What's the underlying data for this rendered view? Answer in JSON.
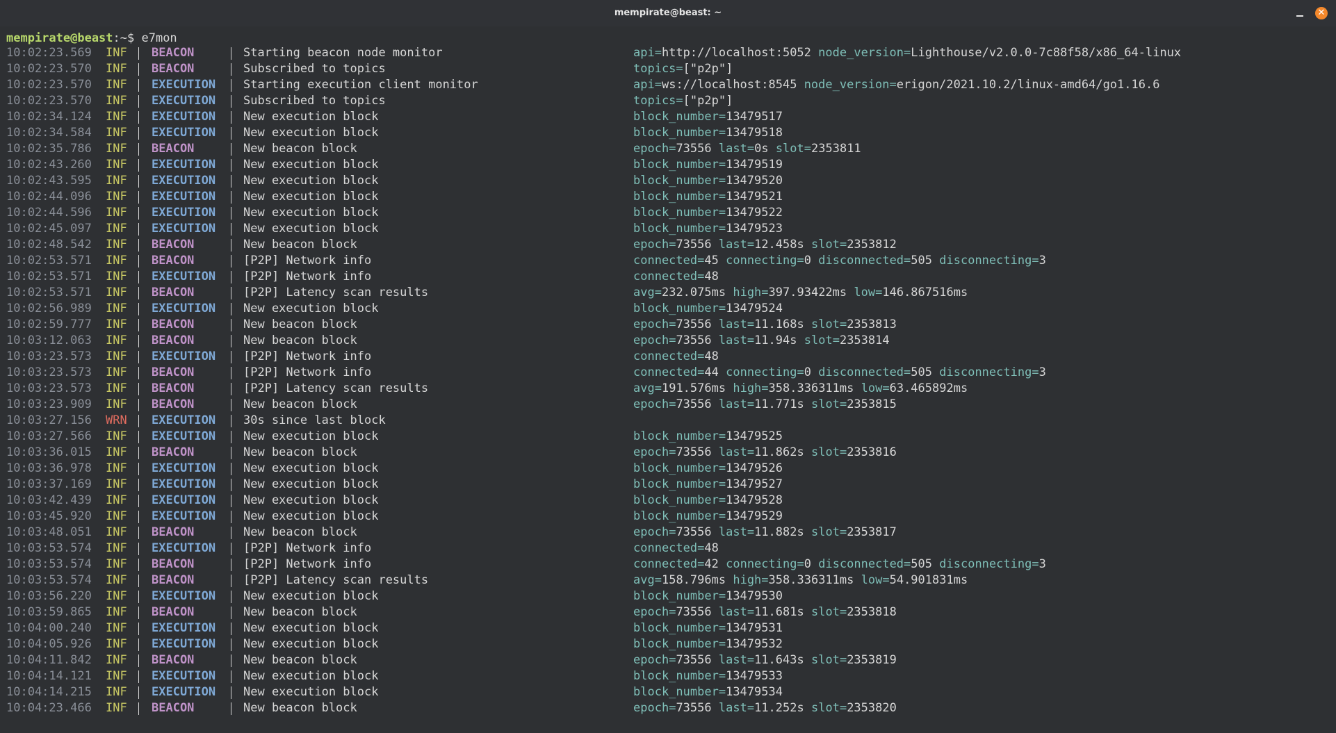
{
  "window": {
    "title": "mempirate@beast: ~",
    "minimize_label": "–",
    "close_label": "✕"
  },
  "prompt": {
    "user_host": "mempirate@beast",
    "path": ":~$ ",
    "command": "e7mon"
  },
  "colors": {
    "background": "#2e3033",
    "inf": "#c9c964",
    "wrn": "#e06c5f",
    "beacon": "#c093c9",
    "execution": "#7fa9d6",
    "field_key": "#7fbfb8",
    "close_button": "#f4882b"
  },
  "log": [
    {
      "time": "10:02:23.569",
      "level": "INF",
      "source": "BEACON",
      "message": "Starting beacon node monitor",
      "fields": [
        {
          "k": "api",
          "v": "http://localhost:5052"
        },
        {
          "k": "node_version",
          "v": "Lighthouse/v2.0.0-7c88f58/x86_64-linux"
        }
      ]
    },
    {
      "time": "10:02:23.570",
      "level": "INF",
      "source": "BEACON",
      "message": "Subscribed to topics",
      "fields": [
        {
          "k": "topics",
          "v": "[\"p2p\"]"
        }
      ]
    },
    {
      "time": "10:02:23.570",
      "level": "INF",
      "source": "EXECUTION",
      "message": "Starting execution client monitor",
      "fields": [
        {
          "k": "api",
          "v": "ws://localhost:8545"
        },
        {
          "k": "node_version",
          "v": "erigon/2021.10.2/linux-amd64/go1.16.6"
        }
      ]
    },
    {
      "time": "10:02:23.570",
      "level": "INF",
      "source": "EXECUTION",
      "message": "Subscribed to topics",
      "fields": [
        {
          "k": "topics",
          "v": "[\"p2p\"]"
        }
      ]
    },
    {
      "time": "10:02:34.124",
      "level": "INF",
      "source": "EXECUTION",
      "message": "New execution block",
      "fields": [
        {
          "k": "block_number",
          "v": "13479517"
        }
      ]
    },
    {
      "time": "10:02:34.584",
      "level": "INF",
      "source": "EXECUTION",
      "message": "New execution block",
      "fields": [
        {
          "k": "block_number",
          "v": "13479518"
        }
      ]
    },
    {
      "time": "10:02:35.786",
      "level": "INF",
      "source": "BEACON",
      "message": "New beacon block",
      "fields": [
        {
          "k": "epoch",
          "v": "73556"
        },
        {
          "k": "last",
          "v": "0s"
        },
        {
          "k": "slot",
          "v": "2353811"
        }
      ]
    },
    {
      "time": "10:02:43.260",
      "level": "INF",
      "source": "EXECUTION",
      "message": "New execution block",
      "fields": [
        {
          "k": "block_number",
          "v": "13479519"
        }
      ]
    },
    {
      "time": "10:02:43.595",
      "level": "INF",
      "source": "EXECUTION",
      "message": "New execution block",
      "fields": [
        {
          "k": "block_number",
          "v": "13479520"
        }
      ]
    },
    {
      "time": "10:02:44.096",
      "level": "INF",
      "source": "EXECUTION",
      "message": "New execution block",
      "fields": [
        {
          "k": "block_number",
          "v": "13479521"
        }
      ]
    },
    {
      "time": "10:02:44.596",
      "level": "INF",
      "source": "EXECUTION",
      "message": "New execution block",
      "fields": [
        {
          "k": "block_number",
          "v": "13479522"
        }
      ]
    },
    {
      "time": "10:02:45.097",
      "level": "INF",
      "source": "EXECUTION",
      "message": "New execution block",
      "fields": [
        {
          "k": "block_number",
          "v": "13479523"
        }
      ]
    },
    {
      "time": "10:02:48.542",
      "level": "INF",
      "source": "BEACON",
      "message": "New beacon block",
      "fields": [
        {
          "k": "epoch",
          "v": "73556"
        },
        {
          "k": "last",
          "v": "12.458s"
        },
        {
          "k": "slot",
          "v": "2353812"
        }
      ]
    },
    {
      "time": "10:02:53.571",
      "level": "INF",
      "source": "BEACON",
      "message": "[P2P] Network info",
      "fields": [
        {
          "k": "connected",
          "v": "45"
        },
        {
          "k": "connecting",
          "v": "0"
        },
        {
          "k": "disconnected",
          "v": "505"
        },
        {
          "k": "disconnecting",
          "v": "3"
        }
      ]
    },
    {
      "time": "10:02:53.571",
      "level": "INF",
      "source": "EXECUTION",
      "message": "[P2P] Network info",
      "fields": [
        {
          "k": "connected",
          "v": "48"
        }
      ]
    },
    {
      "time": "10:02:53.571",
      "level": "INF",
      "source": "BEACON",
      "message": "[P2P] Latency scan results",
      "fields": [
        {
          "k": "avg",
          "v": "232.075ms"
        },
        {
          "k": "high",
          "v": "397.93422ms"
        },
        {
          "k": "low",
          "v": "146.867516ms"
        }
      ]
    },
    {
      "time": "10:02:56.989",
      "level": "INF",
      "source": "EXECUTION",
      "message": "New execution block",
      "fields": [
        {
          "k": "block_number",
          "v": "13479524"
        }
      ]
    },
    {
      "time": "10:02:59.777",
      "level": "INF",
      "source": "BEACON",
      "message": "New beacon block",
      "fields": [
        {
          "k": "epoch",
          "v": "73556"
        },
        {
          "k": "last",
          "v": "11.168s"
        },
        {
          "k": "slot",
          "v": "2353813"
        }
      ]
    },
    {
      "time": "10:03:12.063",
      "level": "INF",
      "source": "BEACON",
      "message": "New beacon block",
      "fields": [
        {
          "k": "epoch",
          "v": "73556"
        },
        {
          "k": "last",
          "v": "11.94s"
        },
        {
          "k": "slot",
          "v": "2353814"
        }
      ]
    },
    {
      "time": "10:03:23.573",
      "level": "INF",
      "source": "EXECUTION",
      "message": "[P2P] Network info",
      "fields": [
        {
          "k": "connected",
          "v": "48"
        }
      ]
    },
    {
      "time": "10:03:23.573",
      "level": "INF",
      "source": "BEACON",
      "message": "[P2P] Network info",
      "fields": [
        {
          "k": "connected",
          "v": "44"
        },
        {
          "k": "connecting",
          "v": "0"
        },
        {
          "k": "disconnected",
          "v": "505"
        },
        {
          "k": "disconnecting",
          "v": "3"
        }
      ]
    },
    {
      "time": "10:03:23.573",
      "level": "INF",
      "source": "BEACON",
      "message": "[P2P] Latency scan results",
      "fields": [
        {
          "k": "avg",
          "v": "191.576ms"
        },
        {
          "k": "high",
          "v": "358.336311ms"
        },
        {
          "k": "low",
          "v": "63.465892ms"
        }
      ]
    },
    {
      "time": "10:03:23.909",
      "level": "INF",
      "source": "BEACON",
      "message": "New beacon block",
      "fields": [
        {
          "k": "epoch",
          "v": "73556"
        },
        {
          "k": "last",
          "v": "11.771s"
        },
        {
          "k": "slot",
          "v": "2353815"
        }
      ]
    },
    {
      "time": "10:03:27.156",
      "level": "WRN",
      "source": "EXECUTION",
      "message": "30s since last block",
      "fields": []
    },
    {
      "time": "10:03:27.566",
      "level": "INF",
      "source": "EXECUTION",
      "message": "New execution block",
      "fields": [
        {
          "k": "block_number",
          "v": "13479525"
        }
      ]
    },
    {
      "time": "10:03:36.015",
      "level": "INF",
      "source": "BEACON",
      "message": "New beacon block",
      "fields": [
        {
          "k": "epoch",
          "v": "73556"
        },
        {
          "k": "last",
          "v": "11.862s"
        },
        {
          "k": "slot",
          "v": "2353816"
        }
      ]
    },
    {
      "time": "10:03:36.978",
      "level": "INF",
      "source": "EXECUTION",
      "message": "New execution block",
      "fields": [
        {
          "k": "block_number",
          "v": "13479526"
        }
      ]
    },
    {
      "time": "10:03:37.169",
      "level": "INF",
      "source": "EXECUTION",
      "message": "New execution block",
      "fields": [
        {
          "k": "block_number",
          "v": "13479527"
        }
      ]
    },
    {
      "time": "10:03:42.439",
      "level": "INF",
      "source": "EXECUTION",
      "message": "New execution block",
      "fields": [
        {
          "k": "block_number",
          "v": "13479528"
        }
      ]
    },
    {
      "time": "10:03:45.920",
      "level": "INF",
      "source": "EXECUTION",
      "message": "New execution block",
      "fields": [
        {
          "k": "block_number",
          "v": "13479529"
        }
      ]
    },
    {
      "time": "10:03:48.051",
      "level": "INF",
      "source": "BEACON",
      "message": "New beacon block",
      "fields": [
        {
          "k": "epoch",
          "v": "73556"
        },
        {
          "k": "last",
          "v": "11.882s"
        },
        {
          "k": "slot",
          "v": "2353817"
        }
      ]
    },
    {
      "time": "10:03:53.574",
      "level": "INF",
      "source": "EXECUTION",
      "message": "[P2P] Network info",
      "fields": [
        {
          "k": "connected",
          "v": "48"
        }
      ]
    },
    {
      "time": "10:03:53.574",
      "level": "INF",
      "source": "BEACON",
      "message": "[P2P] Network info",
      "fields": [
        {
          "k": "connected",
          "v": "42"
        },
        {
          "k": "connecting",
          "v": "0"
        },
        {
          "k": "disconnected",
          "v": "505"
        },
        {
          "k": "disconnecting",
          "v": "3"
        }
      ]
    },
    {
      "time": "10:03:53.574",
      "level": "INF",
      "source": "BEACON",
      "message": "[P2P] Latency scan results",
      "fields": [
        {
          "k": "avg",
          "v": "158.796ms"
        },
        {
          "k": "high",
          "v": "358.336311ms"
        },
        {
          "k": "low",
          "v": "54.901831ms"
        }
      ]
    },
    {
      "time": "10:03:56.220",
      "level": "INF",
      "source": "EXECUTION",
      "message": "New execution block",
      "fields": [
        {
          "k": "block_number",
          "v": "13479530"
        }
      ]
    },
    {
      "time": "10:03:59.865",
      "level": "INF",
      "source": "BEACON",
      "message": "New beacon block",
      "fields": [
        {
          "k": "epoch",
          "v": "73556"
        },
        {
          "k": "last",
          "v": "11.681s"
        },
        {
          "k": "slot",
          "v": "2353818"
        }
      ]
    },
    {
      "time": "10:04:00.240",
      "level": "INF",
      "source": "EXECUTION",
      "message": "New execution block",
      "fields": [
        {
          "k": "block_number",
          "v": "13479531"
        }
      ]
    },
    {
      "time": "10:04:05.926",
      "level": "INF",
      "source": "EXECUTION",
      "message": "New execution block",
      "fields": [
        {
          "k": "block_number",
          "v": "13479532"
        }
      ]
    },
    {
      "time": "10:04:11.842",
      "level": "INF",
      "source": "BEACON",
      "message": "New beacon block",
      "fields": [
        {
          "k": "epoch",
          "v": "73556"
        },
        {
          "k": "last",
          "v": "11.643s"
        },
        {
          "k": "slot",
          "v": "2353819"
        }
      ]
    },
    {
      "time": "10:04:14.121",
      "level": "INF",
      "source": "EXECUTION",
      "message": "New execution block",
      "fields": [
        {
          "k": "block_number",
          "v": "13479533"
        }
      ]
    },
    {
      "time": "10:04:14.215",
      "level": "INF",
      "source": "EXECUTION",
      "message": "New execution block",
      "fields": [
        {
          "k": "block_number",
          "v": "13479534"
        }
      ]
    },
    {
      "time": "10:04:23.466",
      "level": "INF",
      "source": "BEACON",
      "message": "New beacon block",
      "fields": [
        {
          "k": "epoch",
          "v": "73556"
        },
        {
          "k": "last",
          "v": "11.252s"
        },
        {
          "k": "slot",
          "v": "2353820"
        }
      ]
    }
  ]
}
